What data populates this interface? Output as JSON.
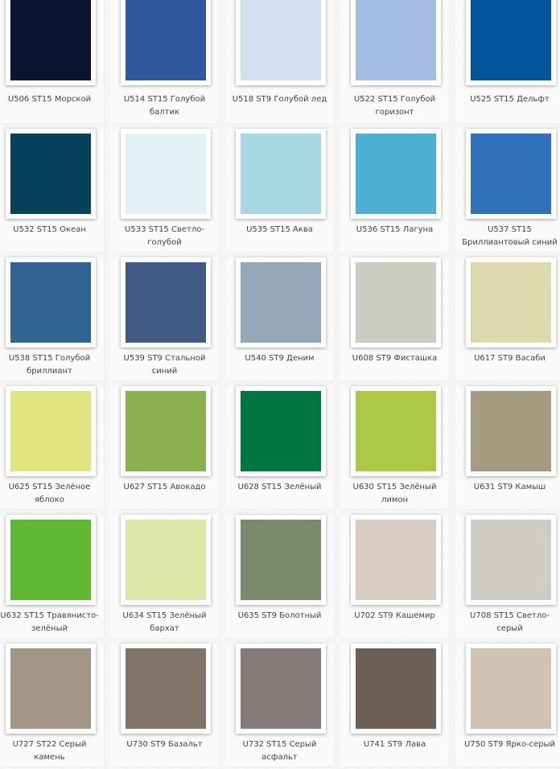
{
  "swatches": [
    {
      "label": "U506 ST15 Морской",
      "color": "#0a1530"
    },
    {
      "label": "U514 ST15 Голубой балтик",
      "color": "#2f58a0"
    },
    {
      "label": "U518 ST9 Голубой лед",
      "color": "#d3e0ef"
    },
    {
      "label": "U522 ST15 Голубой горизонт",
      "color": "#a5bde2"
    },
    {
      "label": "U525 ST15 Дельфт",
      "color": "#02559b"
    },
    {
      "label": "U532 ST15 Океан",
      "color": "#054259"
    },
    {
      "label": "U533 ST15 Светло-голубой",
      "color": "#e2f1f3"
    },
    {
      "label": "U535 ST15 Аква",
      "color": "#a7d7e1"
    },
    {
      "label": "U536 ST15 Лагуна",
      "color": "#4cb0d2"
    },
    {
      "label": "U537 ST15 Бриллиантовый синий",
      "color": "#3171bc"
    },
    {
      "label": "U538 ST15 Голубой бриллиант",
      "color": "#2f6392"
    },
    {
      "label": "U539 ST9 Стальной синий",
      "color": "#405a85"
    },
    {
      "label": "U540 ST9 Деним",
      "color": "#94a8b7"
    },
    {
      "label": "U608 ST9 Фисташка",
      "color": "#c9cdc0"
    },
    {
      "label": "U617 ST9 Васаби",
      "color": "#ddd9ad"
    },
    {
      "label": "U625 ST15 Зелёное яблоко",
      "color": "#e1e47f"
    },
    {
      "label": "U627 ST15 Авокадо",
      "color": "#8bb050"
    },
    {
      "label": "U628 ST15 Зелёный",
      "color": "#027641"
    },
    {
      "label": "U630 ST15 Зелёный лимон",
      "color": "#adc845"
    },
    {
      "label": "U631 ST9 Камыш",
      "color": "#a59b80"
    },
    {
      "label": "U632 ST15 Травянисто-зелёный",
      "color": "#60b734"
    },
    {
      "label": "U634 ST15 Зелёный бархат",
      "color": "#dbe7a6"
    },
    {
      "label": "U635 ST9 Болотный",
      "color": "#7b8a6b"
    },
    {
      "label": "U702 ST9 Кашемир",
      "color": "#d8cbc0"
    },
    {
      "label": "U708 ST15 Светло-серый",
      "color": "#cfcdc6"
    },
    {
      "label": "U727 ST22 Серый камень",
      "color": "#a39584"
    },
    {
      "label": "U730 ST9 Базальт",
      "color": "#837468"
    },
    {
      "label": "U732 ST15 Серый асфальт",
      "color": "#837a79"
    },
    {
      "label": "U741 ST9 Лава",
      "color": "#6c5f55"
    },
    {
      "label": "U750 ST9 Ярко-серый",
      "color": "#d0c3b2"
    }
  ]
}
